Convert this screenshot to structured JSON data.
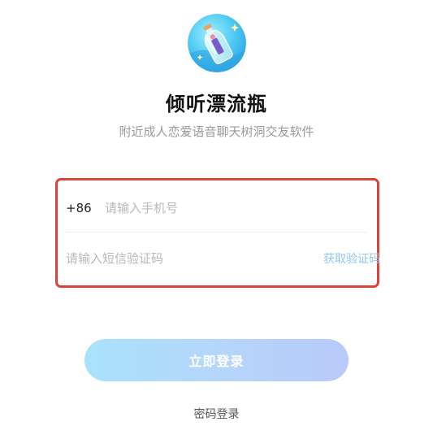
{
  "app": {
    "title": "倾听漂流瓶",
    "subtitle": "附近成人恋爱语音聊天树洞交友软件",
    "logo_icon": "bottle-icon"
  },
  "form": {
    "country_code": "+86",
    "phone_placeholder": "请输入手机号",
    "code_placeholder": "请输入短信验证码",
    "get_code_label": "获取验证码",
    "highlight_color": "#d9443a"
  },
  "actions": {
    "login_label": "立即登录",
    "password_login_label": "密码登录"
  },
  "colors": {
    "button_start": "#a9e2fb",
    "button_end": "#b8c9fa",
    "link": "#8ec7f2"
  }
}
